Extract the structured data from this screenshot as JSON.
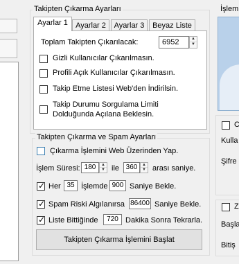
{
  "group_main": {
    "title": "Takipten Çıkarma Ayarları"
  },
  "tabs": [
    {
      "label": "Ayarlar 1",
      "active": true
    },
    {
      "label": "Ayarlar 2",
      "active": false
    },
    {
      "label": "Ayarlar 3",
      "active": false
    },
    {
      "label": "Beyaz Liste",
      "active": false
    }
  ],
  "settings1": {
    "total_label": "Toplam Takipten Çıkarılacak:",
    "total_value": "6952",
    "options": [
      {
        "label": "Gizli Kullanıcılar Çıkarılmasın.",
        "checked": false
      },
      {
        "label": "Profili Açık Kullanıcılar Çıkarılmasın.",
        "checked": false
      },
      {
        "label": "Takip Etme Listesi Web'den İndirilsin.",
        "checked": false
      },
      {
        "label_line1": "Takip Durumu Sorgulama Limiti",
        "label_line2": "Dolduğunda Açılana Beklesin.",
        "checked": false
      }
    ]
  },
  "group_spam": {
    "title": "Takipten Çıkarma ve Spam Ayarları",
    "web_option": {
      "label": "Çıkarma İşlemini Web Üzerinden Yap.",
      "checked": false
    },
    "duration": {
      "label": "İşlem Süresi:",
      "min": "180",
      "between": "ile",
      "max": "360",
      "suffix": "arası saniye."
    },
    "every": {
      "checked": true,
      "prefix": "Her",
      "count": "35",
      "middle": "İşlemde",
      "seconds": "900",
      "suffix": "Saniye Bekle."
    },
    "spam": {
      "checked": true,
      "prefix": "Spam Riski Algılanırsa",
      "seconds": "86400",
      "suffix": "Saniye Bekle."
    },
    "list_end": {
      "checked": true,
      "prefix": "Liste Bittiğinde",
      "minutes": "720",
      "suffix": "Dakika Sonra Tekrarla."
    },
    "start_button": "Takipten Çıkarma İşlemini Başlat"
  },
  "right_panel": {
    "title_partial": "İşlem",
    "checkbox1_partial": "C",
    "label_kulla": "Kulla",
    "label_sifre": "Şifre",
    "checkbox2_partial": "Z",
    "label_basla": "Başla",
    "label_bitis": "Bitiş"
  },
  "colors": {
    "accent_checkbox": "#3c7fb1",
    "button_bg": "#e1e1e1",
    "picture_blue": "#b9d1ea"
  }
}
